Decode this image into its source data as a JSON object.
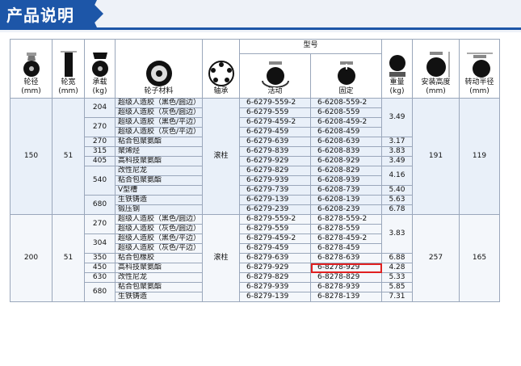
{
  "header": {
    "title": "产品说明"
  },
  "columns": {
    "wheel_dia": "轮径\n(mm)",
    "wheel_width": "轮宽\n(mm)",
    "load": "承载\n(kg)",
    "load_badge": "kg",
    "material": "轮子材料",
    "bearing": "轴承",
    "model": "型号",
    "swivel": "活动",
    "fixed": "固定",
    "weight": "重量\n(kg)",
    "height": "安装高度\n(mm)",
    "radius": "转动半径\n(mm)"
  },
  "groups": [
    {
      "wheel_dia": "150",
      "wheel_width": "51",
      "bearing": "滚柱",
      "height": "191",
      "radius": "119",
      "rows": [
        {
          "load": "204",
          "mat": "超级人造胶（黑色/圆边）",
          "swivel": "6-6279-559-2",
          "fixed": "6-6208-559-2",
          "weight": "3.49"
        },
        {
          "load": "",
          "mat": "超级人造胶（灰色/圆边）",
          "swivel": "6-6279-559",
          "fixed": "6-6208-559",
          "weight": ""
        },
        {
          "load": "270",
          "mat": "超级人造胶（黑色/平边）",
          "swivel": "6-6279-459-2",
          "fixed": "6-6208-459-2",
          "weight": ""
        },
        {
          "load": "",
          "mat": "超级人造胶（灰色/平边）",
          "swivel": "6-6279-459",
          "fixed": "6-6208-459",
          "weight": ""
        },
        {
          "load": "270",
          "mat": "粘合包聚氨酯",
          "swivel": "6-6279-639",
          "fixed": "6-6208-639",
          "weight": "3.17"
        },
        {
          "load": "315",
          "mat": "聚烯烃",
          "swivel": "6-6279-839",
          "fixed": "6-6208-839",
          "weight": "3.83"
        },
        {
          "load": "405",
          "mat": "高科技聚氨酯",
          "swivel": "6-6279-929",
          "fixed": "6-6208-929",
          "weight": "3.49"
        },
        {
          "load": "540",
          "mat": "改性尼龙",
          "swivel": "6-6279-829",
          "fixed": "6-6208-829",
          "weight": "4.16"
        },
        {
          "load": "",
          "mat": "粘合包聚氨酯",
          "swivel": "6-6279-939",
          "fixed": "6-6208-939",
          "weight": ""
        },
        {
          "load": "",
          "mat": "V型槽",
          "swivel": "6-6279-739",
          "fixed": "6-6208-739",
          "weight": "5.40"
        },
        {
          "load": "680",
          "mat": "生铁铸造",
          "swivel": "6-6279-139",
          "fixed": "6-6208-139",
          "weight": "5.63"
        },
        {
          "load": "",
          "mat": "锻压钢",
          "swivel": "6-6279-239",
          "fixed": "6-6208-239",
          "weight": "6.78"
        }
      ]
    },
    {
      "wheel_dia": "200",
      "wheel_width": "51",
      "bearing": "滚柱",
      "height": "257",
      "radius": "165",
      "rows": [
        {
          "load": "270",
          "mat": "超级人造胶（黑色/圆边）",
          "swivel": "6-8279-559-2",
          "fixed": "6-8278-559-2",
          "weight": "3.83"
        },
        {
          "load": "",
          "mat": "超级人造胶（灰色/圆边）",
          "swivel": "6-8279-559",
          "fixed": "6-8278-559",
          "weight": ""
        },
        {
          "load": "304",
          "mat": "超级人造胶（黑色/平边）",
          "swivel": "6-8279-459-2",
          "fixed": "6-8278-459-2",
          "weight": ""
        },
        {
          "load": "",
          "mat": "超级人造胶（灰色/平边）",
          "swivel": "6-8279-459",
          "fixed": "6-8278-459",
          "weight": ""
        },
        {
          "load": "350",
          "mat": "粘合包橡胶",
          "swivel": "6-8279-639",
          "fixed": "6-8278-639",
          "weight": "6.88"
        },
        {
          "load": "450",
          "mat": "高科技聚氨酯",
          "swivel": "6-8279-929",
          "fixed": "6-8278-929",
          "weight": "4.28"
        },
        {
          "load": "630",
          "mat": "改性尼龙",
          "swivel": "6-8279-829",
          "fixed": "6-8278-829",
          "weight": "5.33"
        },
        {
          "load": "680",
          "mat": "粘合包聚氨酯",
          "swivel": "6-8279-939",
          "fixed": "6-8278-939",
          "weight": "5.85"
        },
        {
          "load": "",
          "mat": "生铁铸造",
          "swivel": "6-8279-139",
          "fixed": "6-8278-139",
          "weight": "7.31"
        }
      ]
    }
  ],
  "highlighted_fixed_code": "6-8278-929"
}
